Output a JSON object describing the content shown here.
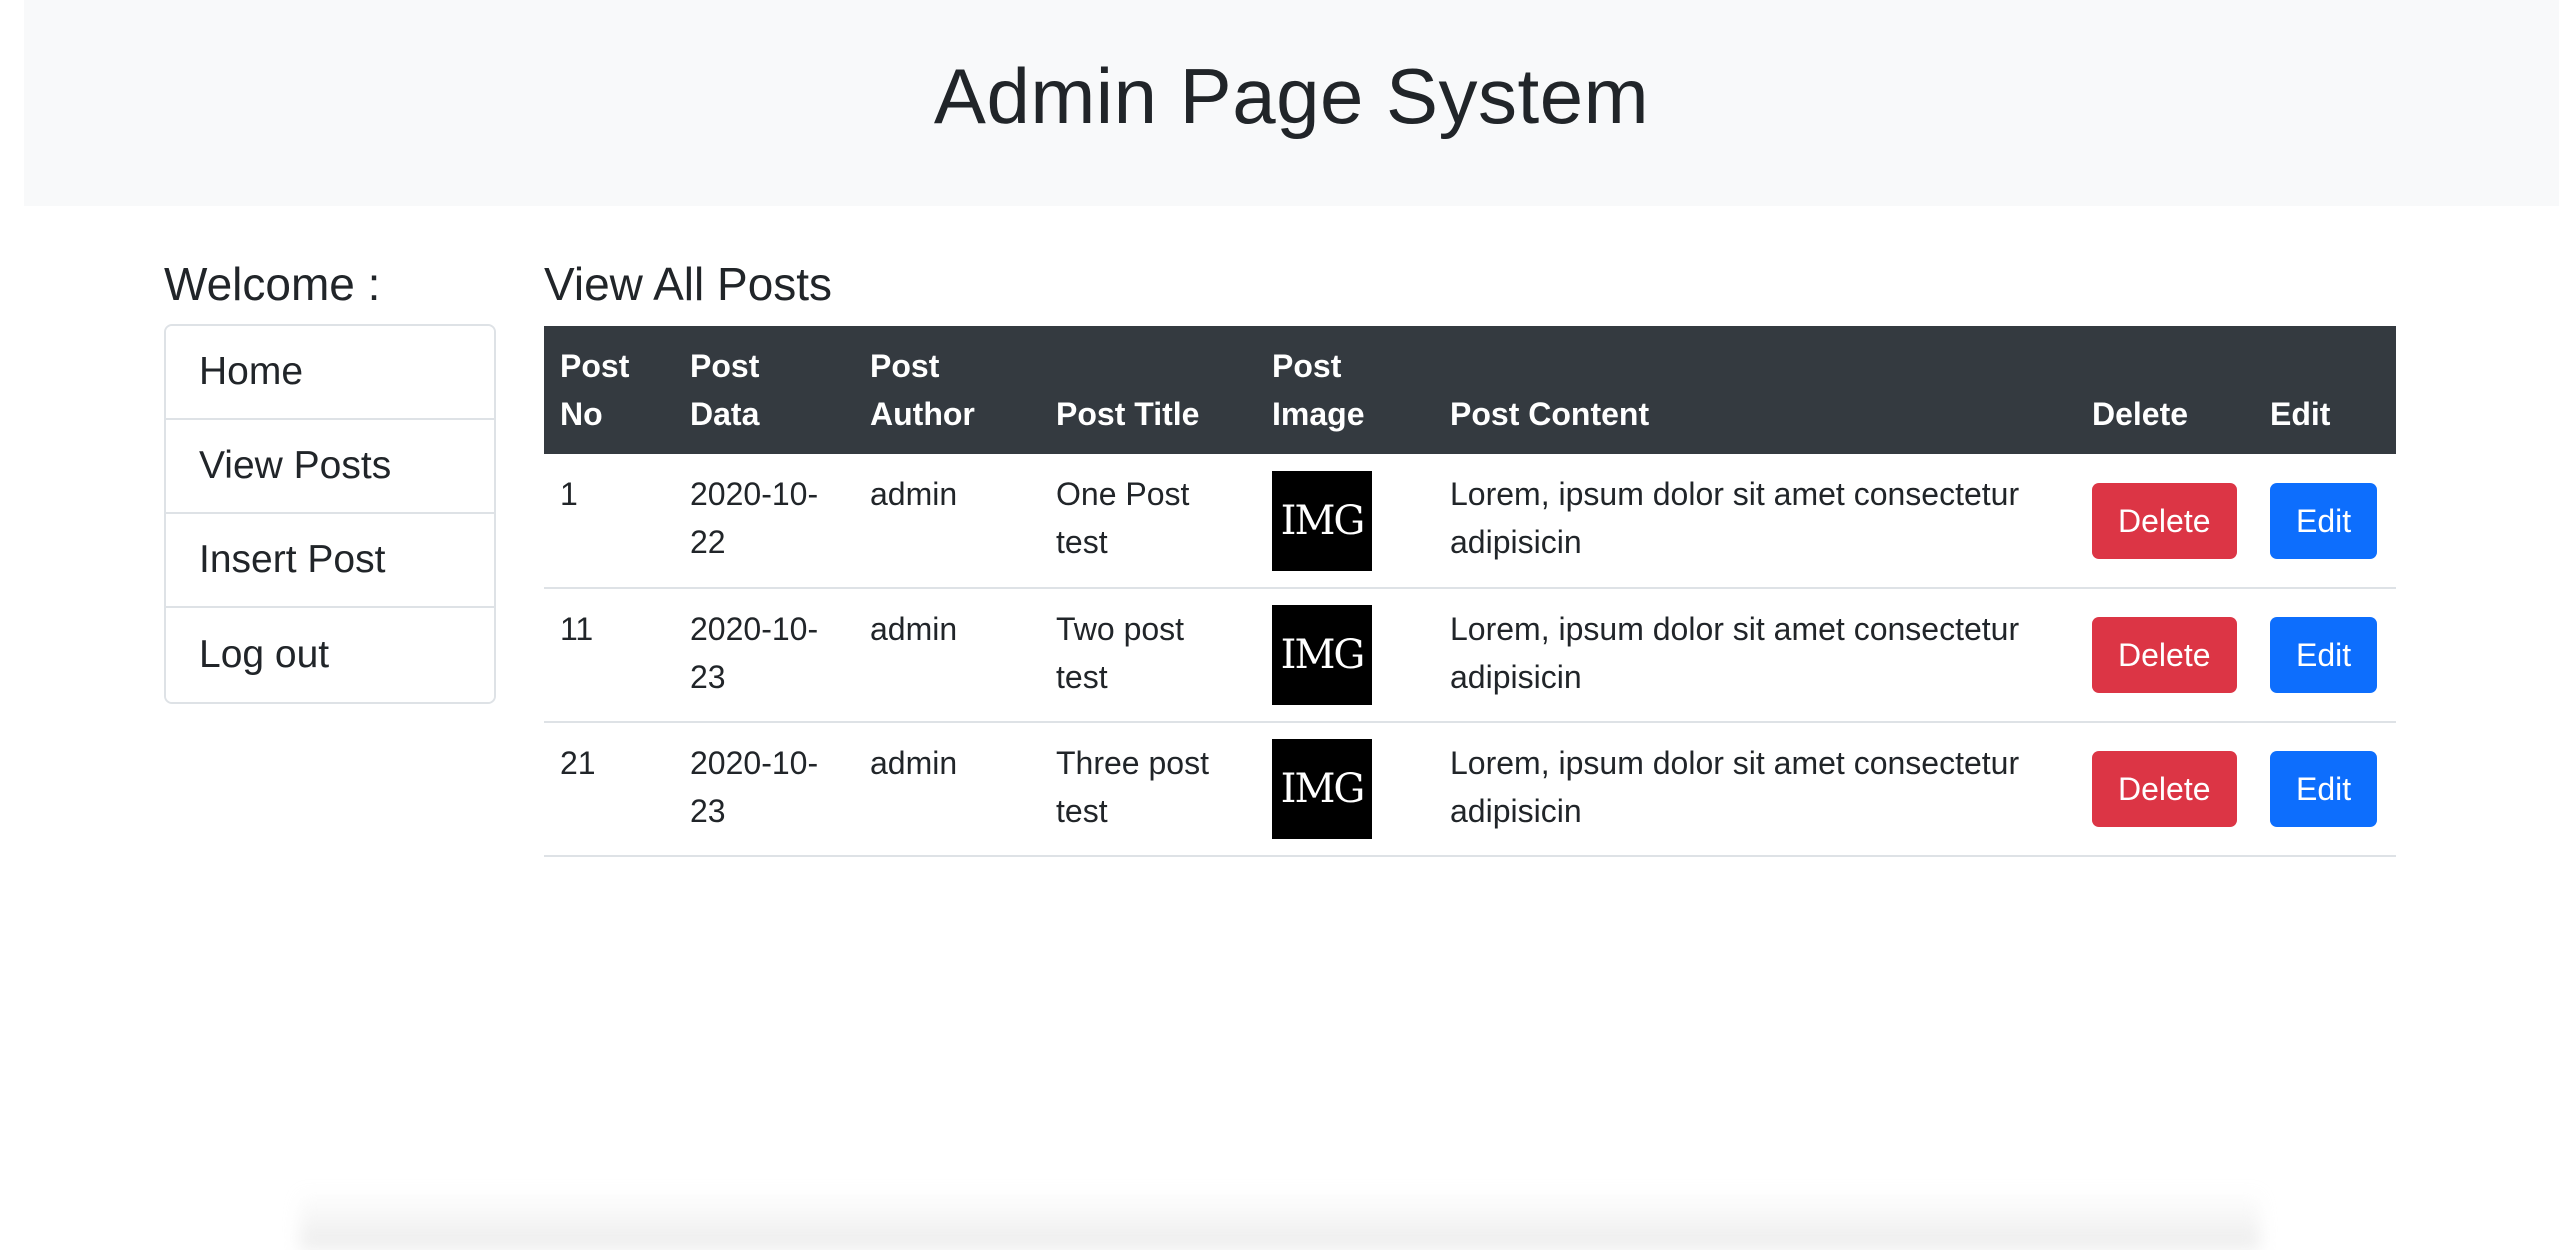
{
  "header": {
    "title": "Admin Page System"
  },
  "sidebar": {
    "welcome": "Welcome :",
    "items": [
      {
        "label": "Home"
      },
      {
        "label": "View Posts"
      },
      {
        "label": "Insert Post"
      },
      {
        "label": "Log out"
      }
    ]
  },
  "main": {
    "title": "View All Posts",
    "columns": [
      "Post No",
      "Post Data",
      "Post Author",
      "Post Title",
      "Post Image",
      "Post Content",
      "Delete",
      "Edit"
    ],
    "rows": [
      {
        "no": "1",
        "date": "2020-10-22",
        "author": "admin",
        "title": "One Post test",
        "image_text": "IMG",
        "content": "Lorem, ipsum dolor sit amet consectetur adipisicin",
        "delete_label": "Delete",
        "edit_label": "Edit"
      },
      {
        "no": "11",
        "date": "2020-10-23",
        "author": "admin",
        "title": "Two post test",
        "image_text": "IMG",
        "content": "Lorem, ipsum dolor sit amet consectetur adipisicin",
        "delete_label": "Delete",
        "edit_label": "Edit"
      },
      {
        "no": "21",
        "date": "2020-10-23",
        "author": "admin",
        "title": "Three post test",
        "image_text": "IMG",
        "content": "Lorem, ipsum dolor sit amet consectetur adipisicin",
        "delete_label": "Delete",
        "edit_label": "Edit"
      }
    ]
  },
  "colors": {
    "header_bg": "#f8f9fa",
    "table_head_bg": "#343a40",
    "delete": "#dc3545",
    "edit": "#0d6efd"
  }
}
